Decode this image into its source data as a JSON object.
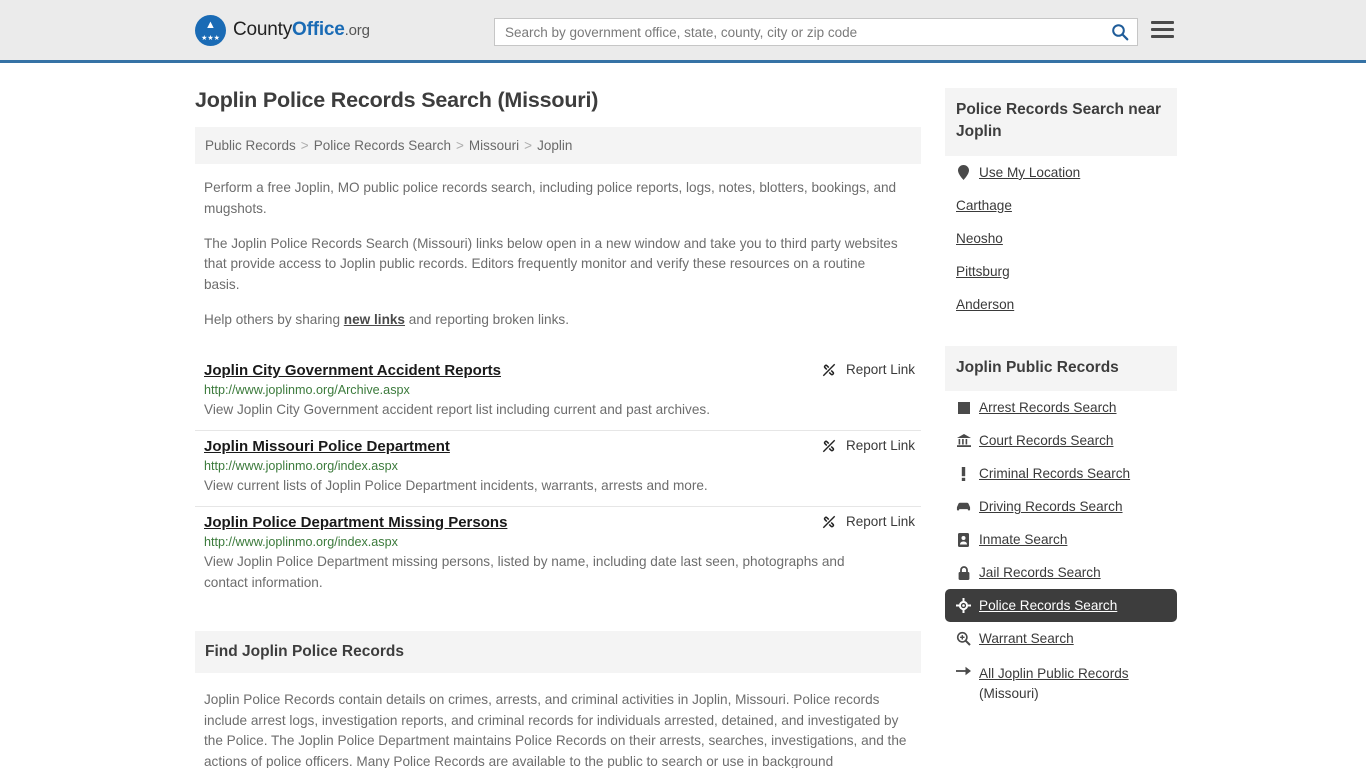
{
  "header": {
    "logo": {
      "part1": "County",
      "part2": "Office",
      "part3": ".org",
      "icon": "eagle-seal-icon"
    },
    "search": {
      "placeholder": "Search by government office, state, county, city or zip code",
      "value": ""
    },
    "search_icon": "search-icon",
    "menu_icon": "hamburger-menu-icon"
  },
  "main": {
    "title": "Joplin Police Records Search (Missouri)",
    "breadcrumb": [
      {
        "label": "Public Records",
        "current": false
      },
      {
        "label": "Police Records Search",
        "current": false
      },
      {
        "label": "Missouri",
        "current": false
      },
      {
        "label": "Joplin",
        "current": true
      }
    ],
    "breadcrumb_separator": ">",
    "intro_1": "Perform a free Joplin, MO public police records search, including police reports, logs, notes, blotters, bookings, and mugshots.",
    "intro_2": "The Joplin Police Records Search (Missouri) links below open in a new window and take you to third party websites that provide access to Joplin public records. Editors frequently monitor and verify these resources on a routine basis.",
    "intro_3_pre": "Help others by sharing ",
    "intro_3_link": "new links",
    "intro_3_post": " and reporting broken links.",
    "report_link_label": "Report Link",
    "report_link_icon": "broken-link-icon",
    "results": [
      {
        "title": "Joplin City Government Accident Reports",
        "url": "http://www.joplinmo.org/Archive.aspx",
        "description": "View Joplin City Government accident report list including current and past archives."
      },
      {
        "title": "Joplin Missouri Police Department",
        "url": "http://www.joplinmo.org/index.aspx",
        "description": "View current lists of Joplin Police Department incidents, warrants, arrests and more."
      },
      {
        "title": "Joplin Police Department Missing Persons",
        "url": "http://www.joplinmo.org/index.aspx",
        "description": "View Joplin Police Department missing persons, listed by name, including date last seen, photographs and contact information."
      }
    ],
    "find_heading": "Find Joplin Police Records",
    "find_body": "Joplin Police Records contain details on crimes, arrests, and criminal activities in Joplin, Missouri. Police records include arrest logs, investigation reports, and criminal records for individuals arrested, detained, and investigated by the Police. The Joplin Police Department maintains Police Records on their arrests, searches, investigations, and the actions of police officers. Many Police Records are available to the public to search or use in background"
  },
  "sidebar": {
    "nearby": {
      "heading": "Police Records Search near Joplin",
      "items": [
        {
          "label": "Use My Location",
          "icon": "map-pin-icon",
          "active": false
        },
        {
          "label": "Carthage",
          "icon": "",
          "active": false
        },
        {
          "label": "Neosho",
          "icon": "",
          "active": false
        },
        {
          "label": "Pittsburg",
          "icon": "",
          "active": false
        },
        {
          "label": "Anderson",
          "icon": "",
          "active": false
        }
      ]
    },
    "public_records": {
      "heading": "Joplin Public Records",
      "items": [
        {
          "label": "Arrest Records Search",
          "icon": "square-icon",
          "active": false
        },
        {
          "label": "Court Records Search",
          "icon": "courthouse-icon",
          "active": false
        },
        {
          "label": "Criminal Records Search",
          "icon": "exclamation-icon",
          "active": false
        },
        {
          "label": "Driving Records Search",
          "icon": "car-icon",
          "active": false
        },
        {
          "label": "Inmate Search",
          "icon": "id-card-icon",
          "active": false
        },
        {
          "label": "Jail Records Search",
          "icon": "padlock-icon",
          "active": false
        },
        {
          "label": "Police Records Search",
          "icon": "crosshair-icon",
          "active": true
        },
        {
          "label": "Warrant Search",
          "icon": "magnifier-plus-icon",
          "active": false
        }
      ],
      "all_records": {
        "label": "All Joplin Public Records",
        "sub": "(Missouri)",
        "icon": "arrow-right-icon"
      }
    }
  },
  "colors": {
    "header_bg": "#ebebeb",
    "header_border": "#3572a5",
    "brand_blue": "#1a6bb5",
    "panel_bg": "#f4f4f4",
    "url_green": "#3b7a3b",
    "active_bg": "#3d3d3d",
    "body_text": "#6d6d6d"
  }
}
